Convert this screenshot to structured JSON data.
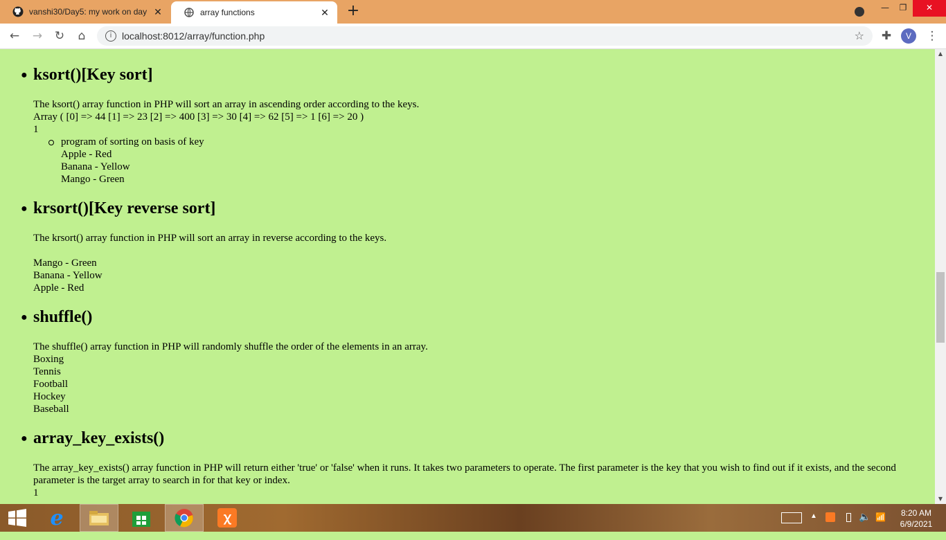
{
  "browser": {
    "tabs": [
      {
        "title": "vanshi30/Day5: my work on day",
        "active": false
      },
      {
        "title": "array functions",
        "active": true
      }
    ],
    "url": "localhost:8012/array/function.php",
    "profile_initial": "V"
  },
  "sections": [
    {
      "heading": "ksort()[Key sort]",
      "description": "The ksort() array function in PHP will sort an array in ascending order according to the keys.",
      "output_lines": [
        "Array ( [0] => 44 [1] => 23 [2] => 400 [3] => 30 [4] => 62 [5] => 1 [6] => 20 )",
        "1"
      ],
      "sub": {
        "label": "program of sorting on basis of key",
        "lines": [
          "Apple - Red",
          "Banana - Yellow",
          "Mango - Green"
        ]
      }
    },
    {
      "heading": "krsort()[Key reverse sort]",
      "description": "The krsort() array function in PHP will sort an array in reverse according to the keys.",
      "output_lines": [
        "Mango - Green",
        "Banana - Yellow",
        "Apple - Red"
      ]
    },
    {
      "heading": "shuffle()",
      "description": "The shuffle() array function in PHP will randomly shuffle the order of the elements in an array.",
      "output_lines": [
        "Boxing",
        "Tennis",
        "Football",
        "Hockey",
        "Baseball"
      ]
    },
    {
      "heading": "array_key_exists()",
      "description": "The array_key_exists() array function in PHP will return either 'true' or 'false' when it runs. It takes two parameters to operate. The first parameter is the key that you wish to find out if it exists, and the second parameter is the target array to search in for that key or index.",
      "output_lines": [
        "1"
      ]
    }
  ],
  "taskbar": {
    "time": "8:20 AM",
    "date": "6/9/2021"
  },
  "colors": {
    "page_bg": "#c0f090",
    "tabstrip_bg": "#e8a464"
  }
}
